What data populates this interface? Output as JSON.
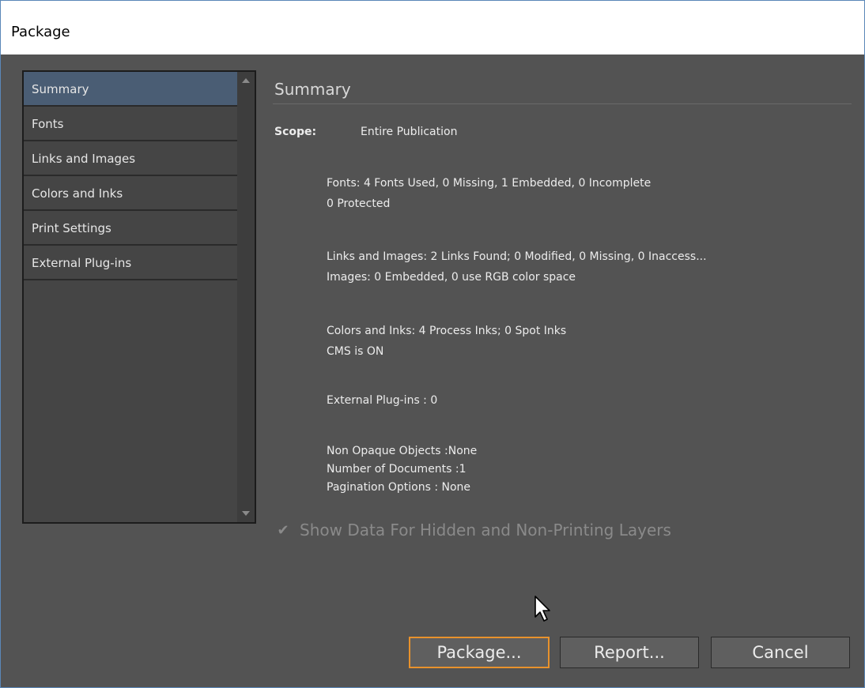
{
  "window": {
    "title": "Package"
  },
  "sidebar": {
    "items": [
      {
        "label": "Summary",
        "selected": true
      },
      {
        "label": "Fonts",
        "selected": false
      },
      {
        "label": "Links and Images",
        "selected": false
      },
      {
        "label": "Colors and Inks",
        "selected": false
      },
      {
        "label": "Print Settings",
        "selected": false
      },
      {
        "label": "External Plug-ins",
        "selected": false
      }
    ]
  },
  "main": {
    "heading": "Summary",
    "scope_label": "Scope:",
    "scope_value": "Entire Publication",
    "fonts_line1": "Fonts: 4 Fonts Used, 0 Missing, 1 Embedded, 0 Incomplete",
    "fonts_line2": "0 Protected",
    "links_line1": "Links and Images: 2 Links Found; 0 Modified, 0 Missing, 0 Inaccess...",
    "links_line2": "Images: 0 Embedded, 0 use RGB color space",
    "colors_line1": "Colors and Inks: 4 Process Inks; 0 Spot Inks",
    "colors_line2": "CMS is ON",
    "plugins_line": "External Plug-ins : 0",
    "opaque_line": "Non Opaque Objects :None",
    "documents_line": "Number of Documents :1",
    "pagination_line": "Pagination Options : None"
  },
  "checkbox": {
    "label": "Show Data For Hidden and Non-Printing Layers",
    "checked": true,
    "enabled": false
  },
  "buttons": {
    "package": "Package...",
    "report": "Report...",
    "cancel": "Cancel"
  },
  "colors": {
    "panel_bg": "#535353",
    "selected_item": "#4a5d74",
    "focus_border": "#e8922c"
  }
}
